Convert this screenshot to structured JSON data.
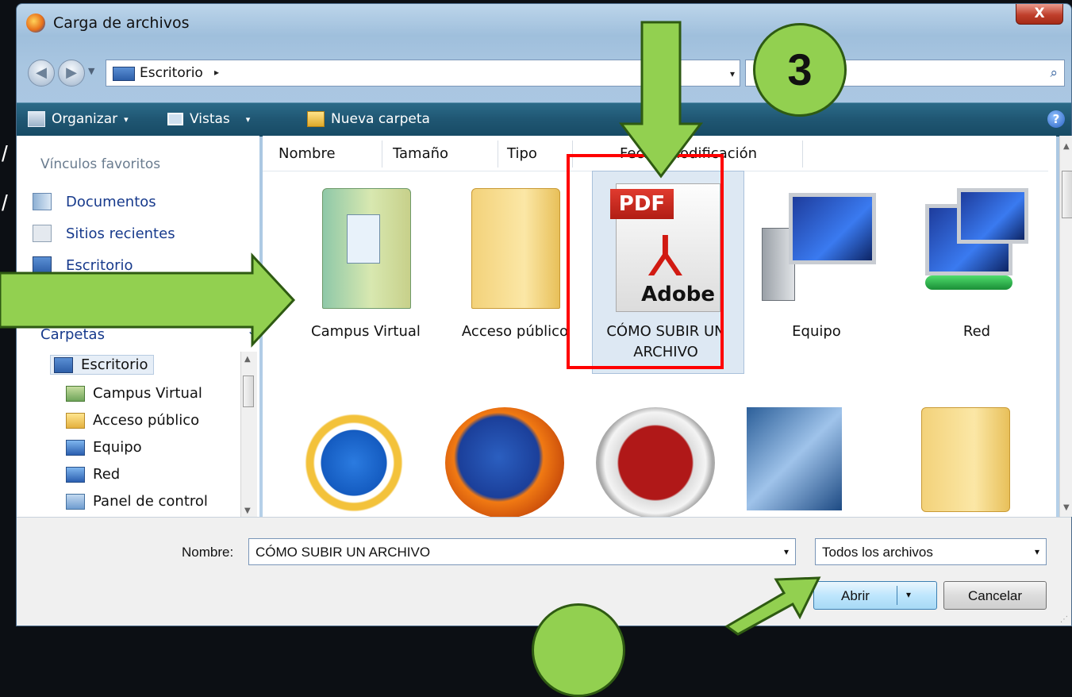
{
  "window": {
    "title": "Carga de archivos",
    "close_label": "X"
  },
  "address": {
    "location": "Escritorio",
    "chevron": "▸",
    "dropdown": "▾",
    "search_glyph": "⌕"
  },
  "toolbar": {
    "organize_label": "Organizar",
    "views_label": "Vistas",
    "new_folder_label": "Nueva carpeta",
    "caret": "▾",
    "help_glyph": "?"
  },
  "nav": {
    "favorites_heading": "Vínculos favoritos",
    "favorites": [
      {
        "label": "Documentos",
        "icon": "documents-icon"
      },
      {
        "label": "Sitios recientes",
        "icon": "recent-places-icon"
      },
      {
        "label": "Escritorio",
        "icon": "desktop-icon"
      }
    ],
    "folders_heading": "Carpetas",
    "folders_chevron": "⌄",
    "tree": [
      {
        "label": "Escritorio",
        "icon": "desktop-icon"
      },
      {
        "label": "Campus Virtual",
        "icon": "campus-folder-icon"
      },
      {
        "label": "Acceso público",
        "icon": "folder-icon"
      },
      {
        "label": "Equipo",
        "icon": "computer-icon"
      },
      {
        "label": "Red",
        "icon": "network-icon"
      },
      {
        "label": "Panel de control",
        "icon": "control-panel-icon"
      }
    ]
  },
  "columns": [
    "Nombre",
    "Tamaño",
    "Tipo",
    "Fecha modificación"
  ],
  "files": [
    {
      "label": "Campus Virtual",
      "icon": "campus-folder-icon"
    },
    {
      "label": "Acceso público",
      "icon": "folder-icon"
    },
    {
      "label_line1": "CÓMO SUBIR UN",
      "label_line2": "ARCHIVO",
      "icon": "pdf-icon",
      "pdf_tag": "PDF",
      "pdf_brand": "Adobe"
    },
    {
      "label": "Equipo",
      "icon": "computer-icon"
    },
    {
      "label": "Red",
      "icon": "network-icon"
    }
  ],
  "files_row2_icons": [
    "internet-explorer-icon",
    "firefox-icon",
    "nero-icon",
    "openoffice-icon",
    "folder-icon"
  ],
  "footer": {
    "name_label": "Nombre:",
    "name_value": "CÓMO SUBIR UN ARCHIVO",
    "type_value": "Todos los archivos",
    "open_label": "Abrir",
    "cancel_label": "Cancelar",
    "dropdown": "▾"
  },
  "annotations": {
    "step_number": "3",
    "arrow_color": "#92d050",
    "highlight_color": "#ff0000"
  }
}
